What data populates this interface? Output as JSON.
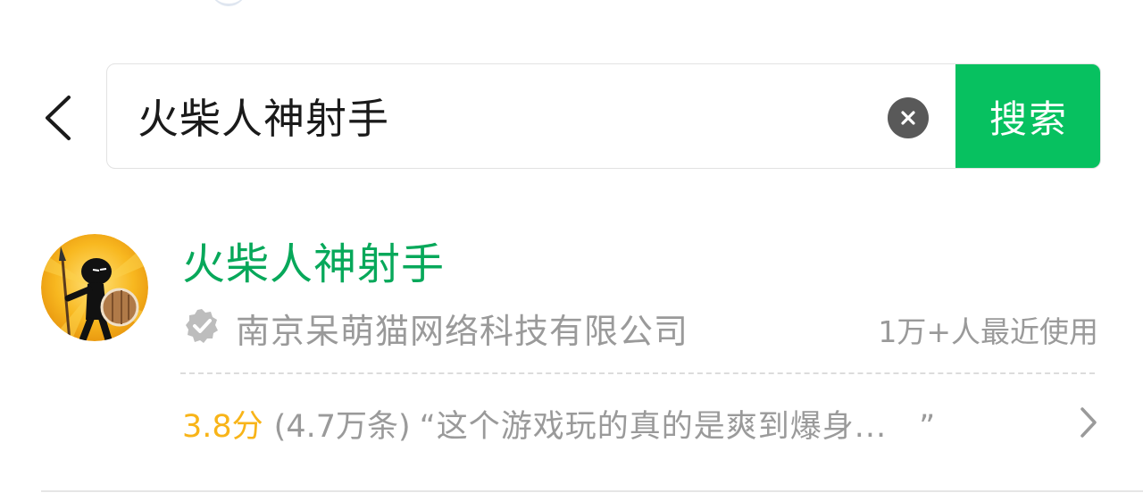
{
  "search": {
    "query": "火柴人神射手",
    "button_label": "搜索"
  },
  "icons": {
    "back": "chevron-left-icon",
    "clear": "close-circle-icon",
    "verified": "verified-badge-icon",
    "more": "chevron-right-icon"
  },
  "colors": {
    "accent": "#07c160",
    "title": "#07a85a",
    "rating": "#f8b418",
    "secondary_text": "#9a9a9a"
  },
  "result": {
    "title": "火柴人神射手",
    "developer": "南京呆萌猫网络科技有限公司",
    "usage": "1万+人最近使用",
    "rating_score": "3.8分",
    "review_count": "(4.7万条)",
    "review_quote": "“这个游戏玩的真的是爽到爆身...　”"
  }
}
